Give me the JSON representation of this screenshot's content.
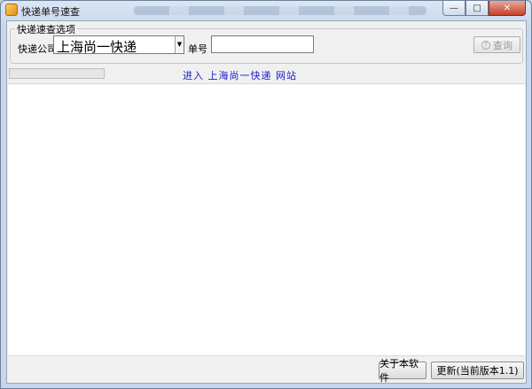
{
  "window": {
    "title": "快递单号速查",
    "minimize_symbol": "—",
    "maximize_symbol": "□",
    "close_symbol": "✕"
  },
  "query_group": {
    "legend": "快递速查选项",
    "company_label": "快递公司",
    "company_selected": "上海尚一快递",
    "number_label": "单号",
    "number_value": "",
    "query_button_label": "查询",
    "query_button_enabled": false
  },
  "status": {
    "progress_fraction": 0.0,
    "site_link_text": "进入 上海尚一快递 网站"
  },
  "footer": {
    "about_label": "关于本软件",
    "update_label": "更新(当前版本1.1)"
  },
  "colors": {
    "link": "#1a1ad0",
    "progress": "#5fbf3f"
  }
}
